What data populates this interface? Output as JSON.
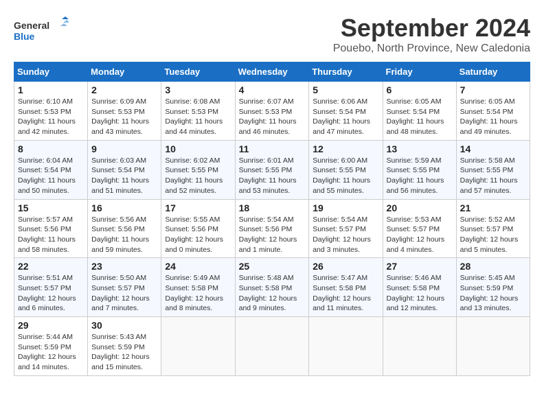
{
  "logo": {
    "line1": "General",
    "line2": "Blue"
  },
  "title": "September 2024",
  "location": "Pouebo, North Province, New Caledonia",
  "weekdays": [
    "Sunday",
    "Monday",
    "Tuesday",
    "Wednesday",
    "Thursday",
    "Friday",
    "Saturday"
  ],
  "weeks": [
    [
      {
        "day": "1",
        "info": "Sunrise: 6:10 AM\nSunset: 5:53 PM\nDaylight: 11 hours\nand 42 minutes."
      },
      {
        "day": "2",
        "info": "Sunrise: 6:09 AM\nSunset: 5:53 PM\nDaylight: 11 hours\nand 43 minutes."
      },
      {
        "day": "3",
        "info": "Sunrise: 6:08 AM\nSunset: 5:53 PM\nDaylight: 11 hours\nand 44 minutes."
      },
      {
        "day": "4",
        "info": "Sunrise: 6:07 AM\nSunset: 5:53 PM\nDaylight: 11 hours\nand 46 minutes."
      },
      {
        "day": "5",
        "info": "Sunrise: 6:06 AM\nSunset: 5:54 PM\nDaylight: 11 hours\nand 47 minutes."
      },
      {
        "day": "6",
        "info": "Sunrise: 6:05 AM\nSunset: 5:54 PM\nDaylight: 11 hours\nand 48 minutes."
      },
      {
        "day": "7",
        "info": "Sunrise: 6:05 AM\nSunset: 5:54 PM\nDaylight: 11 hours\nand 49 minutes."
      }
    ],
    [
      {
        "day": "8",
        "info": "Sunrise: 6:04 AM\nSunset: 5:54 PM\nDaylight: 11 hours\nand 50 minutes."
      },
      {
        "day": "9",
        "info": "Sunrise: 6:03 AM\nSunset: 5:54 PM\nDaylight: 11 hours\nand 51 minutes."
      },
      {
        "day": "10",
        "info": "Sunrise: 6:02 AM\nSunset: 5:55 PM\nDaylight: 11 hours\nand 52 minutes."
      },
      {
        "day": "11",
        "info": "Sunrise: 6:01 AM\nSunset: 5:55 PM\nDaylight: 11 hours\nand 53 minutes."
      },
      {
        "day": "12",
        "info": "Sunrise: 6:00 AM\nSunset: 5:55 PM\nDaylight: 11 hours\nand 55 minutes."
      },
      {
        "day": "13",
        "info": "Sunrise: 5:59 AM\nSunset: 5:55 PM\nDaylight: 11 hours\nand 56 minutes."
      },
      {
        "day": "14",
        "info": "Sunrise: 5:58 AM\nSunset: 5:55 PM\nDaylight: 11 hours\nand 57 minutes."
      }
    ],
    [
      {
        "day": "15",
        "info": "Sunrise: 5:57 AM\nSunset: 5:56 PM\nDaylight: 11 hours\nand 58 minutes."
      },
      {
        "day": "16",
        "info": "Sunrise: 5:56 AM\nSunset: 5:56 PM\nDaylight: 11 hours\nand 59 minutes."
      },
      {
        "day": "17",
        "info": "Sunrise: 5:55 AM\nSunset: 5:56 PM\nDaylight: 12 hours\nand 0 minutes."
      },
      {
        "day": "18",
        "info": "Sunrise: 5:54 AM\nSunset: 5:56 PM\nDaylight: 12 hours\nand 1 minute."
      },
      {
        "day": "19",
        "info": "Sunrise: 5:54 AM\nSunset: 5:57 PM\nDaylight: 12 hours\nand 3 minutes."
      },
      {
        "day": "20",
        "info": "Sunrise: 5:53 AM\nSunset: 5:57 PM\nDaylight: 12 hours\nand 4 minutes."
      },
      {
        "day": "21",
        "info": "Sunrise: 5:52 AM\nSunset: 5:57 PM\nDaylight: 12 hours\nand 5 minutes."
      }
    ],
    [
      {
        "day": "22",
        "info": "Sunrise: 5:51 AM\nSunset: 5:57 PM\nDaylight: 12 hours\nand 6 minutes."
      },
      {
        "day": "23",
        "info": "Sunrise: 5:50 AM\nSunset: 5:57 PM\nDaylight: 12 hours\nand 7 minutes."
      },
      {
        "day": "24",
        "info": "Sunrise: 5:49 AM\nSunset: 5:58 PM\nDaylight: 12 hours\nand 8 minutes."
      },
      {
        "day": "25",
        "info": "Sunrise: 5:48 AM\nSunset: 5:58 PM\nDaylight: 12 hours\nand 9 minutes."
      },
      {
        "day": "26",
        "info": "Sunrise: 5:47 AM\nSunset: 5:58 PM\nDaylight: 12 hours\nand 11 minutes."
      },
      {
        "day": "27",
        "info": "Sunrise: 5:46 AM\nSunset: 5:58 PM\nDaylight: 12 hours\nand 12 minutes."
      },
      {
        "day": "28",
        "info": "Sunrise: 5:45 AM\nSunset: 5:59 PM\nDaylight: 12 hours\nand 13 minutes."
      }
    ],
    [
      {
        "day": "29",
        "info": "Sunrise: 5:44 AM\nSunset: 5:59 PM\nDaylight: 12 hours\nand 14 minutes."
      },
      {
        "day": "30",
        "info": "Sunrise: 5:43 AM\nSunset: 5:59 PM\nDaylight: 12 hours\nand 15 minutes."
      },
      {
        "day": "",
        "info": ""
      },
      {
        "day": "",
        "info": ""
      },
      {
        "day": "",
        "info": ""
      },
      {
        "day": "",
        "info": ""
      },
      {
        "day": "",
        "info": ""
      }
    ]
  ]
}
